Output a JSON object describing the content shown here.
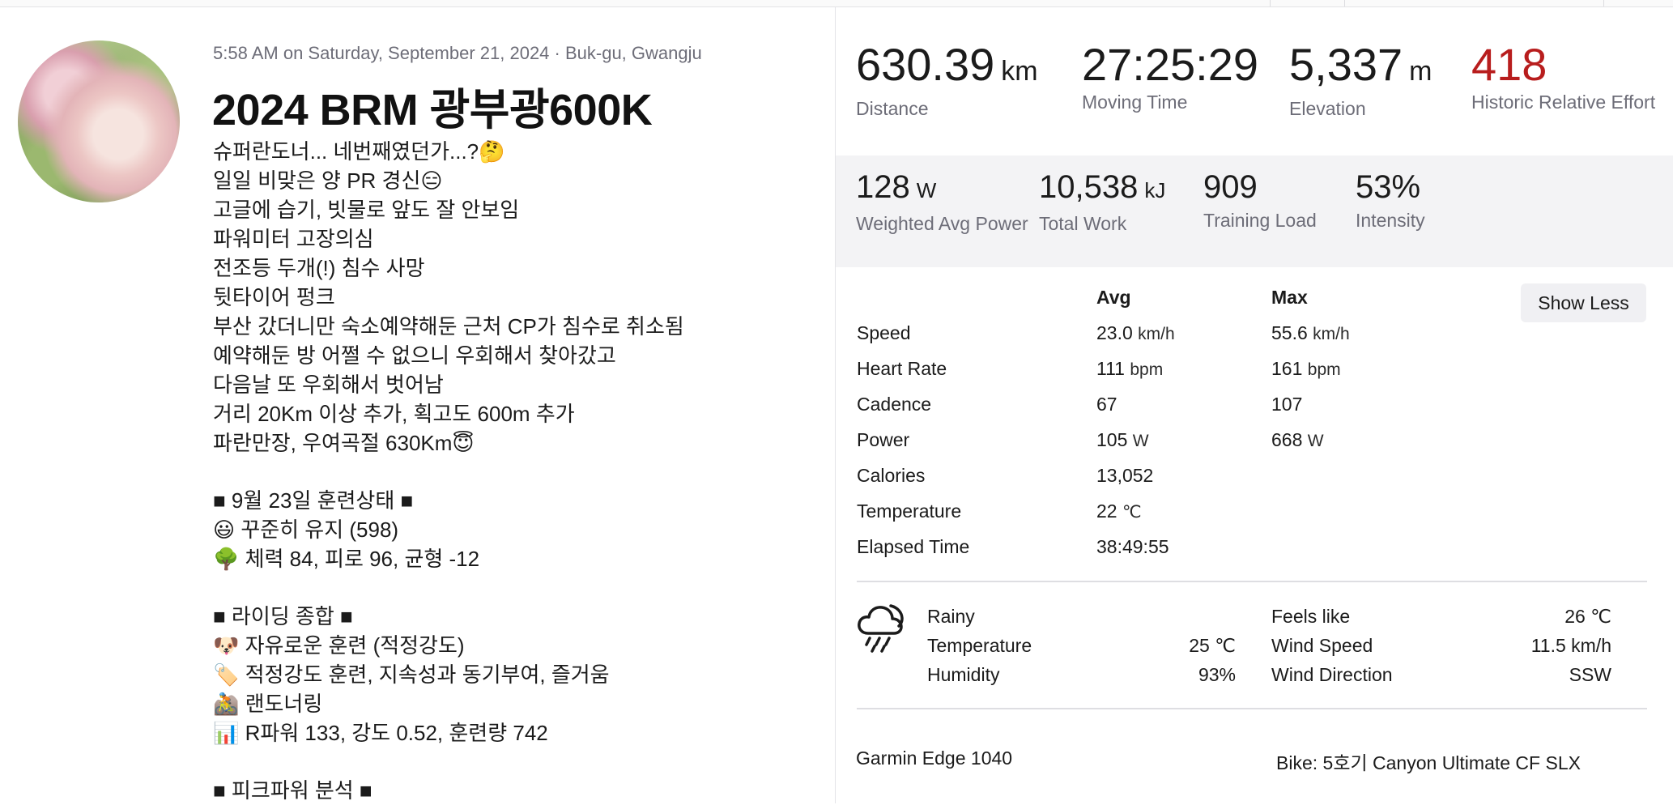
{
  "activity": {
    "meta": "5:58 AM on Saturday, September 21, 2024 · Buk-gu, Gwangju",
    "title": "2024 BRM 광부광600K",
    "description_lines": [
      "슈퍼란도너... 네번째였던가...?🤔",
      "일일 비맞은 양 PR 경신😑",
      "고글에 습기, 빗물로 앞도 잘 안보임",
      "파워미터 고장의심",
      "전조등 두개(!) 침수 사망",
      "뒷타이어 펑크",
      "부산 갔더니만 숙소예약해둔 근처 CP가 침수로 취소됨",
      "예약해둔 방 어쩔 수 없으니 우회해서 찾아갔고",
      "다음날 또 우회해서 벗어남",
      "거리 20Km 이상 추가, 획고도 600m 추가",
      "파란만장, 우여곡절 630Km😇",
      "",
      "■ 9월 23일 훈련상태 ■",
      "😃 꾸준히 유지 (598)",
      "🌳 체력 84, 피로 96, 균형 -12",
      "",
      "■ 라이딩 종합 ■",
      "🐶 자유로운 훈련 (적정강도)",
      "🏷️ 적정강도 훈련, 지속성과 동기부여, 즐거움",
      "🚵 랜도너링",
      "📊 R파워 133, 강도 0.52, 훈련량 742",
      "",
      "■ 피크파워 분석 ■"
    ]
  },
  "primary_stats": [
    {
      "value": "630.39",
      "unit": "km",
      "label": "Distance"
    },
    {
      "value": "27:25:29",
      "unit": "",
      "label": "Moving Time"
    },
    {
      "value": "5,337",
      "unit": "m",
      "label": "Elevation"
    },
    {
      "value": "418",
      "unit": "",
      "label": "Historic Relative Effort",
      "color": "#b81d1d"
    }
  ],
  "secondary_stats": [
    {
      "value": "128",
      "unit": "W",
      "label": "Weighted Avg Power"
    },
    {
      "value": "10,538",
      "unit": "kJ",
      "label": "Total Work"
    },
    {
      "value": "909",
      "unit": "",
      "label": "Training Load"
    },
    {
      "value": "53%",
      "unit": "",
      "label": "Intensity"
    }
  ],
  "details_table": {
    "col_avg": "Avg",
    "col_max": "Max",
    "show_less_label": "Show Less",
    "rows": [
      {
        "label": "Speed",
        "avg": "23.0",
        "avg_unit": "km/h",
        "max": "55.6",
        "max_unit": "km/h"
      },
      {
        "label": "Heart Rate",
        "avg": "111",
        "avg_unit": "bpm",
        "max": "161",
        "max_unit": "bpm"
      },
      {
        "label": "Cadence",
        "avg": "67",
        "avg_unit": "",
        "max": "107",
        "max_unit": ""
      },
      {
        "label": "Power",
        "avg": "105",
        "avg_unit": "W",
        "max": "668",
        "max_unit": "W"
      },
      {
        "label": "Calories",
        "avg": "13,052",
        "avg_unit": "",
        "max": "",
        "max_unit": ""
      },
      {
        "label": "Temperature",
        "avg": "22",
        "avg_unit": "℃",
        "max": "",
        "max_unit": ""
      },
      {
        "label": "Elapsed Time",
        "avg": "38:49:55",
        "avg_unit": "",
        "max": "",
        "max_unit": ""
      }
    ]
  },
  "weather": {
    "icon": "rain-cloud-icon",
    "condition": "Rainy",
    "temperature_label": "Temperature",
    "temperature_value": "25 ℃",
    "humidity_label": "Humidity",
    "humidity_value": "93%",
    "feels_like_label": "Feels like",
    "feels_like_value": "26 ℃",
    "wind_speed_label": "Wind Speed",
    "wind_speed_value": "11.5 km/h",
    "wind_direction_label": "Wind Direction",
    "wind_direction_value": "SSW"
  },
  "gear": {
    "device": "Garmin Edge 1040",
    "bike": "Bike: 5호기 Canyon Ultimate CF SLX"
  },
  "colors": {
    "effort_red": "#b81d1d",
    "muted_label": "#6d6d78",
    "stats_band_bg": "#f3f3f5"
  }
}
